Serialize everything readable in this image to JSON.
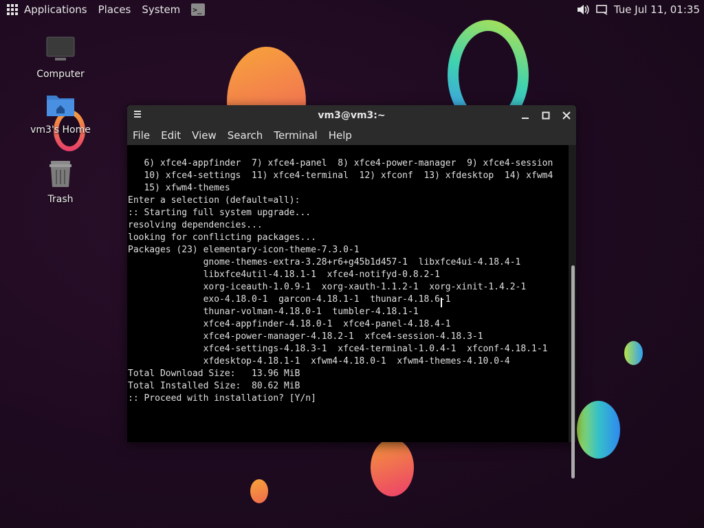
{
  "panel": {
    "menus": [
      "Applications",
      "Places",
      "System"
    ],
    "terminal_launcher_glyph": ">_",
    "clock": "Tue Jul 11, 01:35"
  },
  "desktop": {
    "icons": [
      {
        "label": "Computer",
        "icon": "computer-icon"
      },
      {
        "label": "vm3's Home",
        "icon": "home-folder-icon"
      },
      {
        "label": "Trash",
        "icon": "trash-icon"
      }
    ]
  },
  "terminal": {
    "title": "vm3@vm3:~",
    "menus": [
      "File",
      "Edit",
      "View",
      "Search",
      "Terminal",
      "Help"
    ],
    "lines": [
      "   6) xfce4-appfinder  7) xfce4-panel  8) xfce4-power-manager  9) xfce4-session",
      "   10) xfce4-settings  11) xfce4-terminal  12) xfconf  13) xfdesktop  14) xfwm4",
      "   15) xfwm4-themes",
      "",
      "Enter a selection (default=all):",
      ":: Starting full system upgrade...",
      "resolving dependencies...",
      "looking for conflicting packages...",
      "",
      "Packages (23) elementary-icon-theme-7.3.0-1",
      "              gnome-themes-extra-3.28+r6+g45b1d457-1  libxfce4ui-4.18.4-1",
      "              libxfce4util-4.18.1-1  xfce4-notifyd-0.8.2-1",
      "              xorg-iceauth-1.0.9-1  xorg-xauth-1.1.2-1  xorg-xinit-1.4.2-1",
      "              exo-4.18.0-1  garcon-4.18.1-1  thunar-4.18.6-1",
      "              thunar-volman-4.18.0-1  tumbler-4.18.1-1",
      "              xfce4-appfinder-4.18.0-1  xfce4-panel-4.18.4-1",
      "              xfce4-power-manager-4.18.2-1  xfce4-session-4.18.3-1",
      "              xfce4-settings-4.18.3-1  xfce4-terminal-1.0.4-1  xfconf-4.18.1-1",
      "              xfdesktop-4.18.1-1  xfwm4-4.18.0-1  xfwm4-themes-4.10.0-4",
      "",
      "Total Download Size:   13.96 MiB",
      "Total Installed Size:  80.62 MiB",
      "",
      ":: Proceed with installation? [Y/n]"
    ]
  },
  "colors": {
    "desktop_bg": "#1e0a20",
    "titlebar": "#2b2b2b",
    "terminal_bg": "#000000"
  }
}
